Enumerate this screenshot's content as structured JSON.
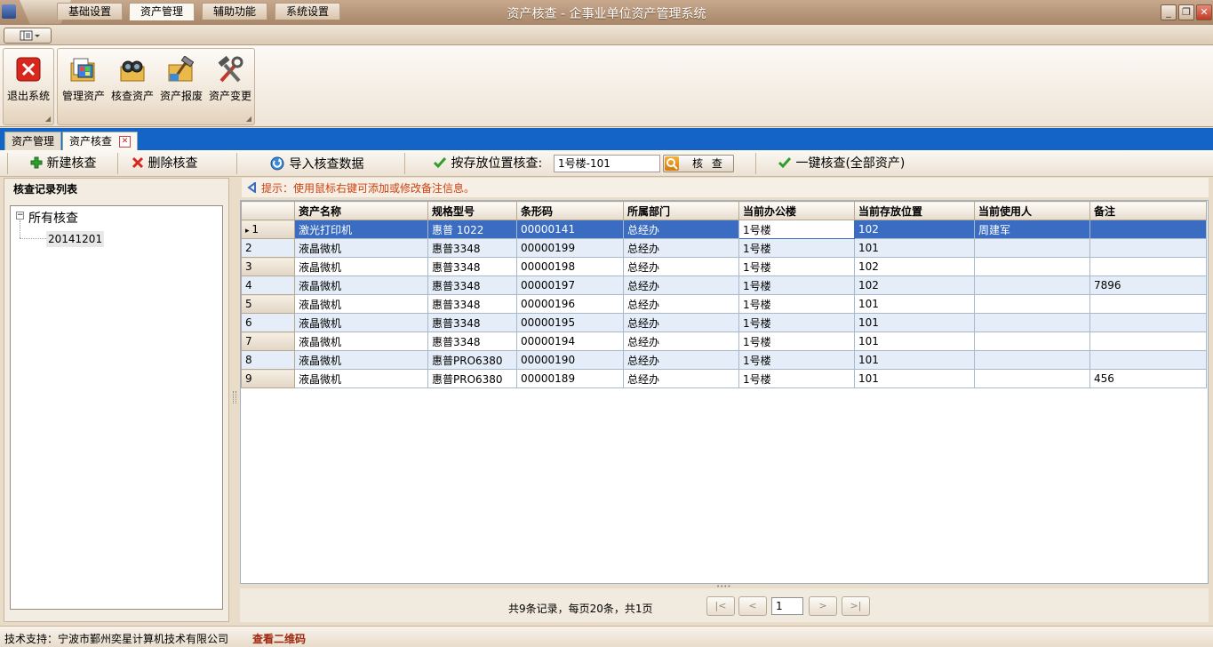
{
  "window": {
    "title": "资产核查 - 企事业单位资产管理系统",
    "minimize": "_",
    "restore": "❐",
    "close": "✕"
  },
  "ribbon": {
    "tabs": [
      "基础设置",
      "资产管理",
      "辅助功能",
      "系统设置"
    ],
    "active_tab": "资产管理",
    "groups": {
      "system": {
        "exit_label": "退出系统"
      },
      "assets": {
        "manage_label": "管理资产",
        "check_label": "核查资产",
        "scrap_label": "资产报废",
        "change_label": "资产变更"
      }
    }
  },
  "doc_tabs": [
    "资产管理",
    "资产核查"
  ],
  "toolbar": {
    "new_check": "新建核查",
    "delete_check": "删除核查",
    "import_data": "导入核查数据",
    "by_location_label": "按存放位置核查:",
    "location_value": "1号楼-101",
    "check_button": "核 查",
    "one_click": "一键核查(全部资产)"
  },
  "left_panel": {
    "header": "核查记录列表",
    "tree_root": "所有核查",
    "tree_child": "20141201"
  },
  "tip": "提示：使用鼠标右键可添加或修改备注信息。",
  "grid": {
    "columns": [
      "资产名称",
      "规格型号",
      "条形码",
      "所属部门",
      "当前办公楼",
      "当前存放位置",
      "当前使用人",
      "备注"
    ],
    "rows": [
      {
        "n": "1",
        "name": "激光打印机",
        "model": "惠普 1022",
        "barcode": "00000141",
        "dept": "总经办",
        "building": "1号楼",
        "location": "102",
        "user": "周建军",
        "note": ""
      },
      {
        "n": "2",
        "name": "液晶微机",
        "model": "惠普3348",
        "barcode": "00000199",
        "dept": "总经办",
        "building": "1号楼",
        "location": "101",
        "user": "",
        "note": ""
      },
      {
        "n": "3",
        "name": "液晶微机",
        "model": "惠普3348",
        "barcode": "00000198",
        "dept": "总经办",
        "building": "1号楼",
        "location": "102",
        "user": "",
        "note": ""
      },
      {
        "n": "4",
        "name": "液晶微机",
        "model": "惠普3348",
        "barcode": "00000197",
        "dept": "总经办",
        "building": "1号楼",
        "location": "102",
        "user": "",
        "note": "7896"
      },
      {
        "n": "5",
        "name": "液晶微机",
        "model": "惠普3348",
        "barcode": "00000196",
        "dept": "总经办",
        "building": "1号楼",
        "location": "101",
        "user": "",
        "note": ""
      },
      {
        "n": "6",
        "name": "液晶微机",
        "model": "惠普3348",
        "barcode": "00000195",
        "dept": "总经办",
        "building": "1号楼",
        "location": "101",
        "user": "",
        "note": ""
      },
      {
        "n": "7",
        "name": "液晶微机",
        "model": "惠普3348",
        "barcode": "00000194",
        "dept": "总经办",
        "building": "1号楼",
        "location": "101",
        "user": "",
        "note": ""
      },
      {
        "n": "8",
        "name": "液晶微机",
        "model": "惠普PRO6380",
        "barcode": "00000190",
        "dept": "总经办",
        "building": "1号楼",
        "location": "101",
        "user": "",
        "note": ""
      },
      {
        "n": "9",
        "name": "液晶微机",
        "model": "惠普PRO6380",
        "barcode": "00000189",
        "dept": "总经办",
        "building": "1号楼",
        "location": "101",
        "user": "",
        "note": "456"
      }
    ]
  },
  "pager": {
    "info": "共9条记录，每页20条，共1页",
    "first": "|<",
    "prev": "<",
    "page": "1",
    "next": ">",
    "last": ">|"
  },
  "status": {
    "support": "技术支持：宁波市鄞州奕星计算机技术有限公司",
    "qr_link": "查看二维码"
  }
}
